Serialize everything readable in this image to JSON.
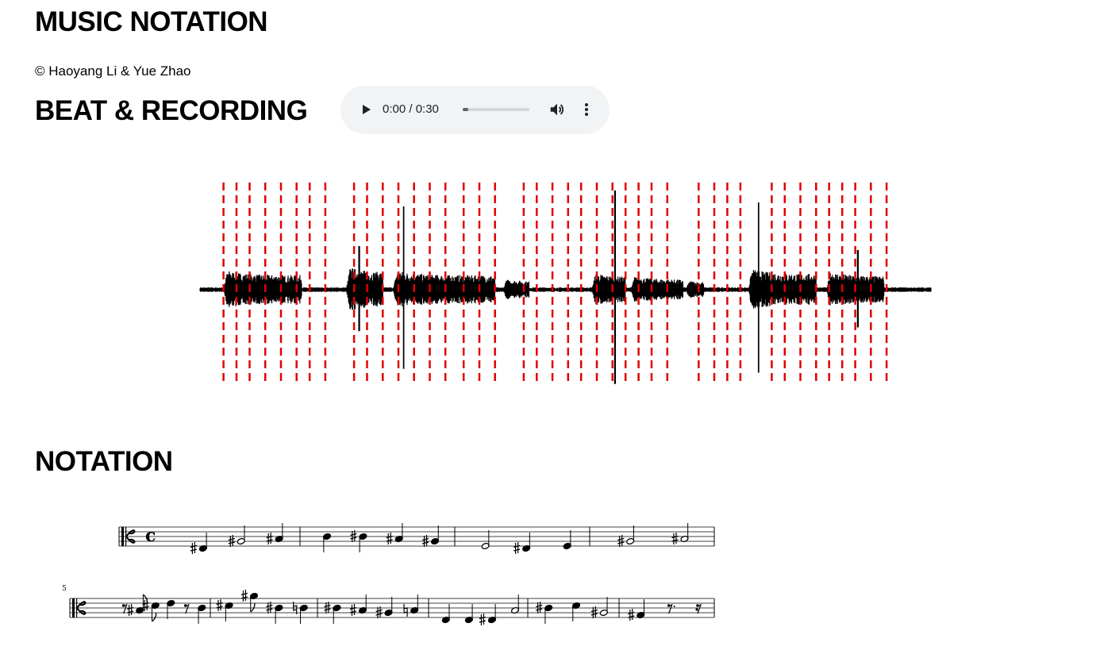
{
  "page": {
    "title": "MUSIC NOTATION",
    "credit": "© Haoyang Li & Yue Zhao"
  },
  "beat_section": {
    "heading": "BEAT & RECORDING",
    "audio": {
      "current_time": "0:00",
      "duration": "0:30",
      "time_display": "0:00 / 0:30",
      "progress_fraction": 0.08
    },
    "beat_times_sec": [
      0.9,
      1.4,
      1.9,
      2.5,
      3.1,
      3.7,
      4.2,
      4.8,
      5.9,
      6.4,
      7.0,
      7.6,
      8.2,
      8.8,
      9.4,
      10.1,
      10.7,
      11.3,
      12.4,
      12.9,
      13.5,
      14.1,
      14.6,
      15.2,
      15.8,
      16.3,
      16.8,
      17.3,
      17.9,
      19.1,
      19.7,
      20.2,
      20.7,
      21.9,
      22.4,
      23.0,
      23.6,
      24.1,
      24.6,
      25.1,
      25.7,
      26.3
    ],
    "waveform_duration_sec": 28.0,
    "beat_color": "#e00000",
    "waveform_color": "#000000"
  },
  "notation_section": {
    "heading": "NOTATION",
    "clef": "alto",
    "time_signature": "c",
    "second_system_measure_number": "5",
    "systems": [
      {
        "measures": [
          [
            {
              "pos": -5,
              "acc": "sharp",
              "dur": "q"
            },
            {
              "pos": -2,
              "acc": "sharp",
              "dur": "h"
            },
            {
              "pos": -1,
              "acc": "sharp",
              "dur": "q"
            }
          ],
          [
            {
              "pos": 0,
              "acc": "",
              "dur": "q"
            },
            {
              "pos": 0,
              "acc": "sharp",
              "dur": "q"
            },
            {
              "pos": -1,
              "acc": "sharp",
              "dur": "q"
            },
            {
              "pos": -2,
              "acc": "sharp",
              "dur": "q"
            }
          ],
          [
            {
              "pos": -4,
              "acc": "",
              "dur": "h"
            },
            {
              "pos": -5,
              "acc": "sharp",
              "dur": "q"
            },
            {
              "pos": -4,
              "acc": "",
              "dur": "q"
            }
          ],
          [
            {
              "pos": -2,
              "acc": "sharp",
              "dur": "h"
            },
            {
              "pos": -1,
              "acc": "sharp",
              "dur": "h"
            }
          ]
        ]
      },
      {
        "measures": [
          [
            {
              "rest": "8"
            },
            {
              "pos": -1,
              "acc": "sharp",
              "dur": "8"
            },
            {
              "pos": 1,
              "acc": "sharp",
              "dur": "8"
            },
            {
              "pos": 2,
              "acc": "",
              "dur": "q"
            },
            {
              "rest": "8"
            },
            {
              "pos": 0,
              "acc": "",
              "dur": "q"
            }
          ],
          [
            {
              "pos": 1,
              "acc": "sharp",
              "dur": "q"
            },
            {
              "pos": 5,
              "acc": "sharp",
              "dur": "8"
            },
            {
              "pos": 0,
              "acc": "sharp",
              "dur": "q"
            },
            {
              "pos": 0,
              "acc": "natural",
              "dur": "q"
            }
          ],
          [
            {
              "pos": 0,
              "acc": "sharp",
              "dur": "q"
            },
            {
              "pos": -1,
              "acc": "sharp",
              "dur": "q"
            },
            {
              "pos": -2,
              "acc": "sharp",
              "dur": "q"
            },
            {
              "pos": -1,
              "acc": "natural",
              "dur": "q"
            }
          ],
          [
            {
              "pos": -5,
              "acc": "",
              "dur": "q"
            },
            {
              "pos": -5,
              "acc": "",
              "dur": "q"
            },
            {
              "pos": -5,
              "acc": "sharp",
              "dur": "q"
            },
            {
              "pos": -1,
              "acc": "",
              "dur": "h"
            }
          ],
          [
            {
              "pos": 0,
              "acc": "sharp",
              "dur": "q"
            },
            {
              "pos": 1,
              "acc": "",
              "dur": "q"
            },
            {
              "pos": -2,
              "acc": "sharp",
              "dur": "h"
            }
          ],
          [
            {
              "pos": -3,
              "acc": "sharp",
              "dur": "q"
            },
            {
              "rest": "8d"
            },
            {
              "rest": "16"
            }
          ]
        ]
      }
    ]
  }
}
